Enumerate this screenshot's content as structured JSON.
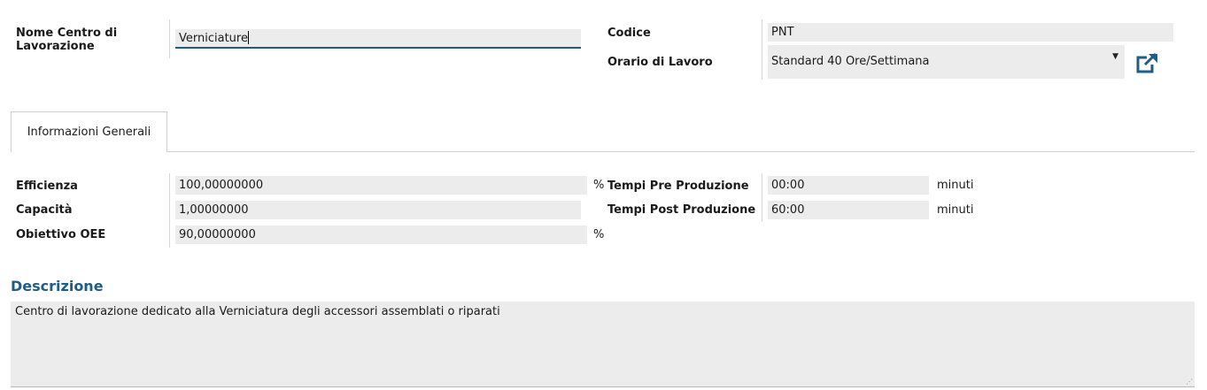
{
  "header": {
    "name_label": "Nome Centro di Lavorazione",
    "name_value": "Verniciature",
    "code_label": "Codice",
    "code_value": "PNT",
    "schedule_label": "Orario di Lavoro",
    "schedule_value": "Standard 40 Ore/Settimana"
  },
  "tabs": [
    {
      "label": "Informazioni Generali",
      "active": true
    }
  ],
  "general": {
    "efficiency_label": "Efficienza",
    "efficiency_value": "100,00000000",
    "efficiency_unit": "%",
    "capacity_label": "Capacità",
    "capacity_value": "1,00000000",
    "oee_label": "Obiettivo OEE",
    "oee_value": "90,00000000",
    "oee_unit": "%",
    "pre_label": "Tempi Pre Produzione",
    "pre_value": "00:00",
    "pre_unit": "minuti",
    "post_label": "Tempi Post Produzione",
    "post_value": "60:00",
    "post_unit": "minuti"
  },
  "description": {
    "title": "Descrizione",
    "text": "Centro di lavorazione dedicato alla Verniciatura degli accessori assemblati o riparati"
  },
  "icons": {
    "external_link": "external-link-icon",
    "dropdown": "caret-down-icon",
    "resize": "resize-grip-icon"
  },
  "colors": {
    "accent": "#1f5d85",
    "field_bg": "#ececec"
  }
}
